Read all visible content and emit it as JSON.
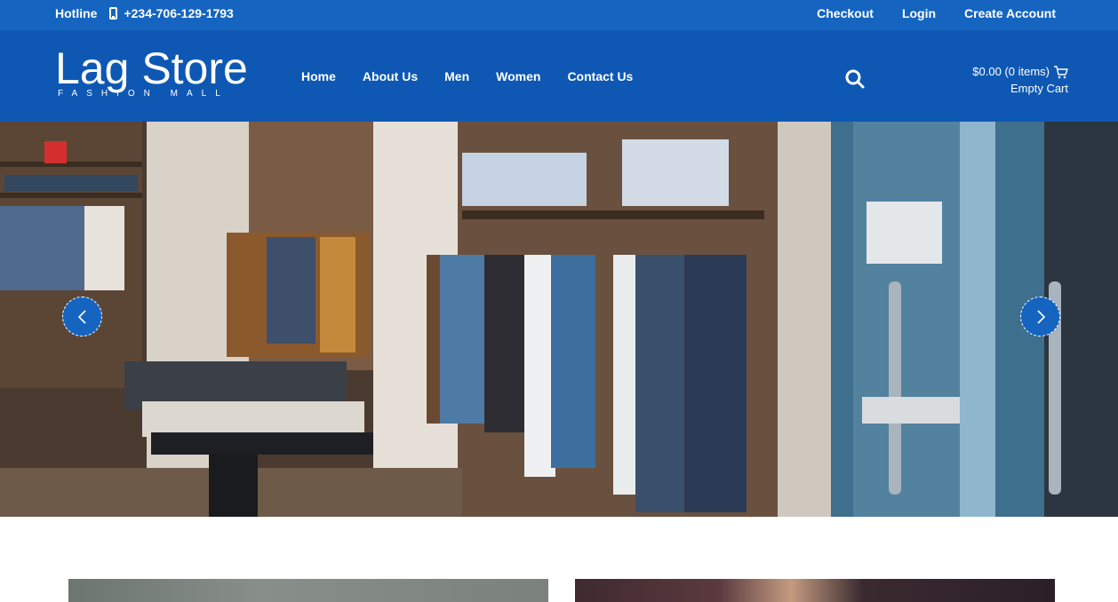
{
  "topbar": {
    "hotline_label": "Hotline",
    "phone": "+234-706-129-1793",
    "links": [
      "Checkout",
      "Login",
      "Create Account"
    ]
  },
  "header": {
    "logo_title": "Lag Store",
    "logo_tagline": "FASHION MALL",
    "nav": [
      "Home",
      "About Us",
      "Men",
      "Women",
      "Contact Us"
    ],
    "cart_summary": "$0.00 (0 items)",
    "cart_status": "Empty Cart"
  },
  "colors": {
    "topbar": "#1565c0",
    "header": "#0e58b3",
    "accent": "#1565c0"
  },
  "icons": {
    "phone": "phone-icon",
    "search": "search-icon",
    "cart": "cart-icon",
    "prev": "chevron-left-icon",
    "next": "chevron-right-icon"
  }
}
